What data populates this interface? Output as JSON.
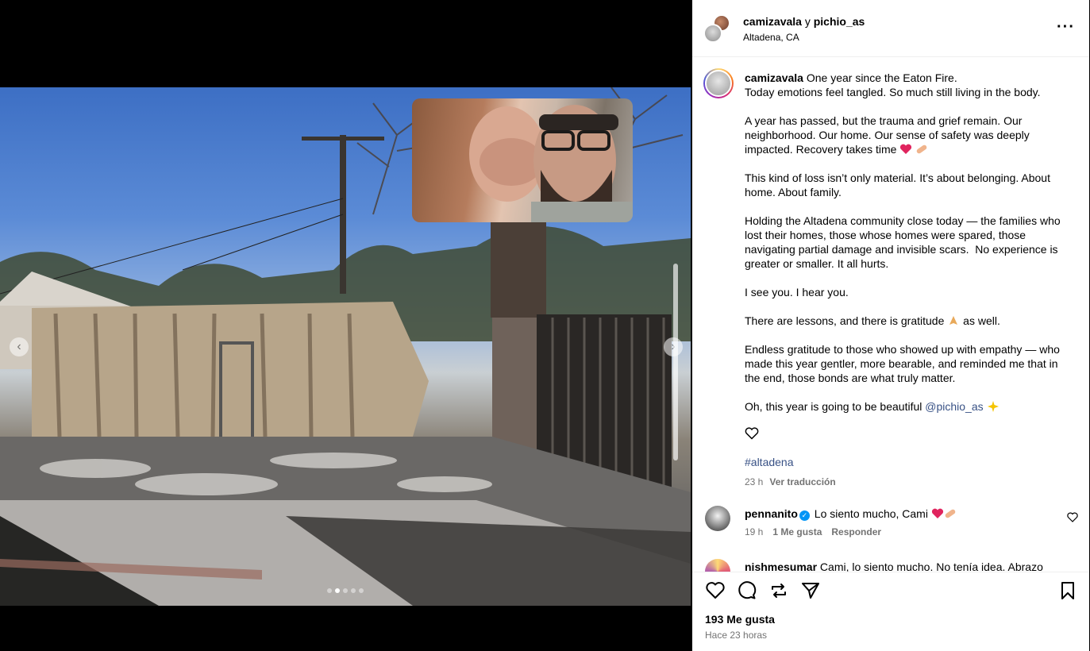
{
  "header": {
    "user1": "camizavala",
    "joiner": " y ",
    "user2": "pichio_as",
    "location": "Altadena, CA",
    "more_label": "···"
  },
  "media": {
    "prev_icon": "chevron-left-icon",
    "next_icon": "chevron-right-icon",
    "slide_count": 5,
    "active_slide": 2
  },
  "caption": {
    "username": "camizavala",
    "p1_line1": " One year since the Eaton Fire.",
    "p1_line2": "Today emotions feel tangled. So much still living in the body.",
    "p2": "A year has passed, but the trauma and grief remain. Our neighborhood. Our home. Our sense of safety was deeply impacted. Recovery takes time ",
    "p3": "This kind of loss isn’t only material. It’s about belonging. About home. About family.",
    "p4": "Holding the Altadena community close today — the families who lost their homes, those whose homes were spared, those navigating partial damage and invisible scars.  No experience is greater or smaller. It all hurts.",
    "p5": "I see you. I hear you.",
    "p6_before": "There are lessons, and there is gratitude ",
    "p6_after": " as well.",
    "p7": "Endless gratitude to those who showed up with empathy — who made this year gentler, more bearable, and reminded me that in the end, those bonds are what truly matter.",
    "p8_before": "Oh, this year is going to be beautiful ",
    "p8_mention": "@pichio_as",
    "hashtag": "#altadena",
    "time": "23 h",
    "translate": "Ver traducción"
  },
  "comments": [
    {
      "user": "pennanito",
      "text": " Lo siento mucho, Cami ",
      "time": "19 h",
      "likes": "1 Me gusta",
      "reply": "Responder"
    },
    {
      "user": "nishmesumar",
      "text": " Cami, lo siento mucho. No tenía idea. Abrazo"
    }
  ],
  "footer": {
    "likes": "193 Me gusta",
    "time_ago": "Hace 23 horas"
  },
  "colors": {
    "link": "#385185",
    "muted": "#737373",
    "verified": "#0095f6",
    "heart": "#e0245e"
  }
}
